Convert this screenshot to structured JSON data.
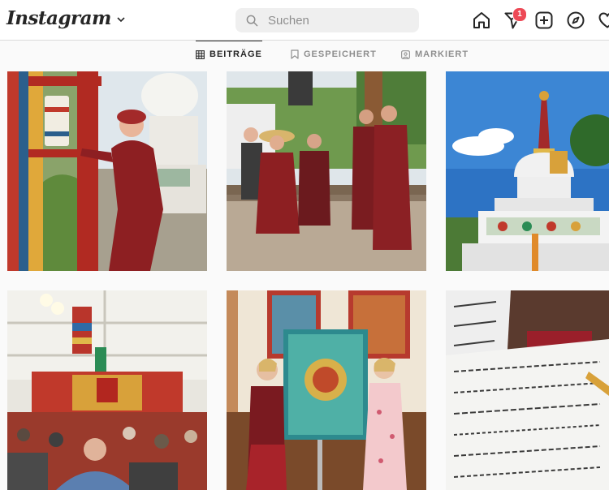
{
  "header": {
    "brand": "Instagram",
    "search_placeholder": "Suchen",
    "notification_count": "1",
    "icons": [
      "chevron-down-icon",
      "search-icon",
      "home-icon",
      "direct-message-icon",
      "new-post-icon",
      "explore-icon",
      "activity-heart-icon"
    ]
  },
  "tabs": [
    {
      "label": "BEITRÄGE",
      "icon": "grid-icon",
      "active": true
    },
    {
      "label": "GESPEICHERT",
      "icon": "bookmark-icon",
      "active": false
    },
    {
      "label": "MARKIERT",
      "icon": "tagged-icon",
      "active": false
    }
  ],
  "posts": [
    {
      "subject": "nun-at-prayer-wheel-and-stupa"
    },
    {
      "subject": "group-of-monks-on-wooden-deck"
    },
    {
      "subject": "white-stupa-blue-sky"
    },
    {
      "subject": "teaching-tent-with-audience"
    },
    {
      "subject": "two-women-holding-thangka"
    },
    {
      "subject": "tibetan-calligraphy-page"
    }
  ],
  "colors": {
    "brand_text": "#262626",
    "badge": "#ed4956",
    "search_bg": "#efefef",
    "page_bg": "#fafafa",
    "divider": "#dbdbdb"
  }
}
